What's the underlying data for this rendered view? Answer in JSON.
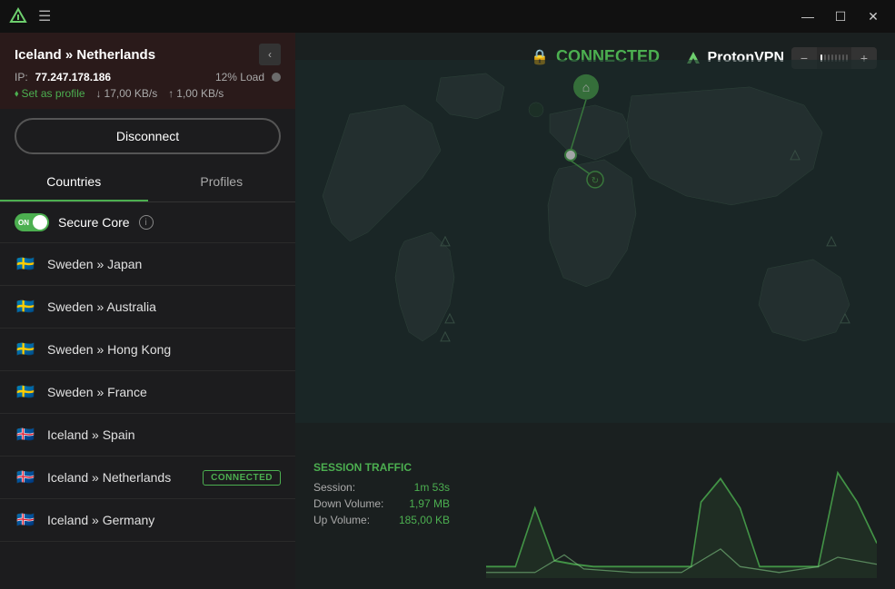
{
  "titlebar": {
    "logo": "▶",
    "menu_label": "☰",
    "minimize_label": "—",
    "maximize_label": "☐",
    "close_label": "✕"
  },
  "connection": {
    "title": "Iceland » Netherlands",
    "ip_label": "IP:",
    "ip_value": "77.247.178.186",
    "load_pct": "12% Load",
    "set_profile_label": "Set as profile",
    "download_speed": "17,00 KB/s",
    "upload_speed": "1,00 KB/s",
    "disconnect_label": "Disconnect"
  },
  "tabs": {
    "countries_label": "Countries",
    "profiles_label": "Profiles"
  },
  "secure_core": {
    "toggle_label": "ON",
    "label": "Secure Core",
    "info": "i"
  },
  "vpn_items": [
    {
      "flag": "🇸🇪",
      "label": "Sweden » Japan",
      "connected": false
    },
    {
      "flag": "🇸🇪",
      "label": "Sweden » Australia",
      "connected": false
    },
    {
      "flag": "🇸🇪",
      "label": "Sweden » Hong Kong",
      "connected": false
    },
    {
      "flag": "🇸🇪",
      "label": "Sweden » France",
      "connected": false
    },
    {
      "flag": "🇮🇸",
      "label": "Iceland » Spain",
      "connected": false
    },
    {
      "flag": "🇮🇸",
      "label": "Iceland » Netherlands",
      "connected": true
    },
    {
      "flag": "🇮🇸",
      "label": "Iceland » Germany",
      "connected": false
    }
  ],
  "connected_badge": "CONNECTED",
  "map": {
    "status_label": "CONNECTED",
    "lock_icon": "🔒",
    "brand_label": "ProtonVPN",
    "brand_icon": "▷"
  },
  "session": {
    "title": "Session Traffic",
    "session_label": "Session:",
    "session_value": "1m 53s",
    "down_label": "Down Volume:",
    "down_value": "1,97   MB",
    "up_label": "Up Volume:",
    "up_value": "185,00  KB"
  },
  "zoom": {
    "minus": "−",
    "plus": "+"
  }
}
